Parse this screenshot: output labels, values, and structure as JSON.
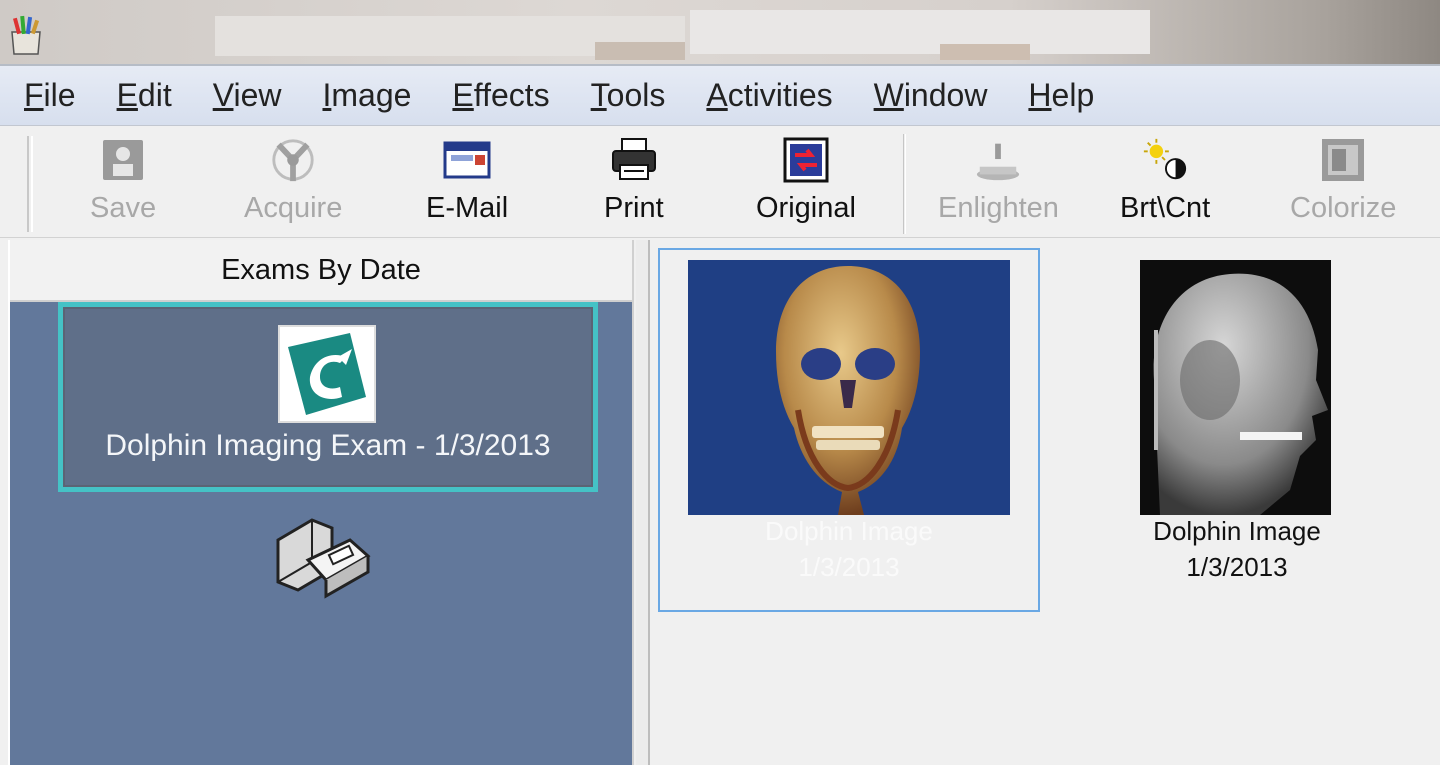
{
  "menu": {
    "items": [
      {
        "label": "File"
      },
      {
        "label": "Edit"
      },
      {
        "label": "View"
      },
      {
        "label": "Image"
      },
      {
        "label": "Effects"
      },
      {
        "label": "Tools"
      },
      {
        "label": "Activities"
      },
      {
        "label": "Window"
      },
      {
        "label": "Help"
      }
    ]
  },
  "toolbar": {
    "save": {
      "label": "Save",
      "icon": "save-icon"
    },
    "acquire": {
      "label": "Acquire",
      "icon": "acquire-icon"
    },
    "email": {
      "label": "E-Mail",
      "icon": "email-icon"
    },
    "print": {
      "label": "Print",
      "icon": "printer-icon"
    },
    "original": {
      "label": "Original",
      "icon": "original-icon"
    },
    "enlighten": {
      "label": "Enlighten",
      "icon": "enlighten-icon"
    },
    "brtcnt": {
      "label": "Brt\\Cnt",
      "icon": "brightness-contrast-icon"
    },
    "colorize": {
      "label": "Colorize",
      "icon": "colorize-icon"
    }
  },
  "left_panel": {
    "header": "Exams By Date",
    "exam": {
      "label": "Dolphin Imaging Exam - 1/3/2013",
      "icon": "dolphin-logo-icon"
    },
    "scanner_icon": "scanner-icon"
  },
  "thumbnails": [
    {
      "title": "Dolphin Image",
      "date": "1/3/2013",
      "selected": true,
      "kind": "3d-skull-render"
    },
    {
      "title": "Dolphin Image",
      "date": "1/3/2013",
      "selected": false,
      "kind": "lateral-ceph-xray"
    }
  ],
  "colors": {
    "selection_border": "#45c2c6",
    "panel_bg": "#62789b",
    "thumb_selection": "#6aa8e4"
  }
}
